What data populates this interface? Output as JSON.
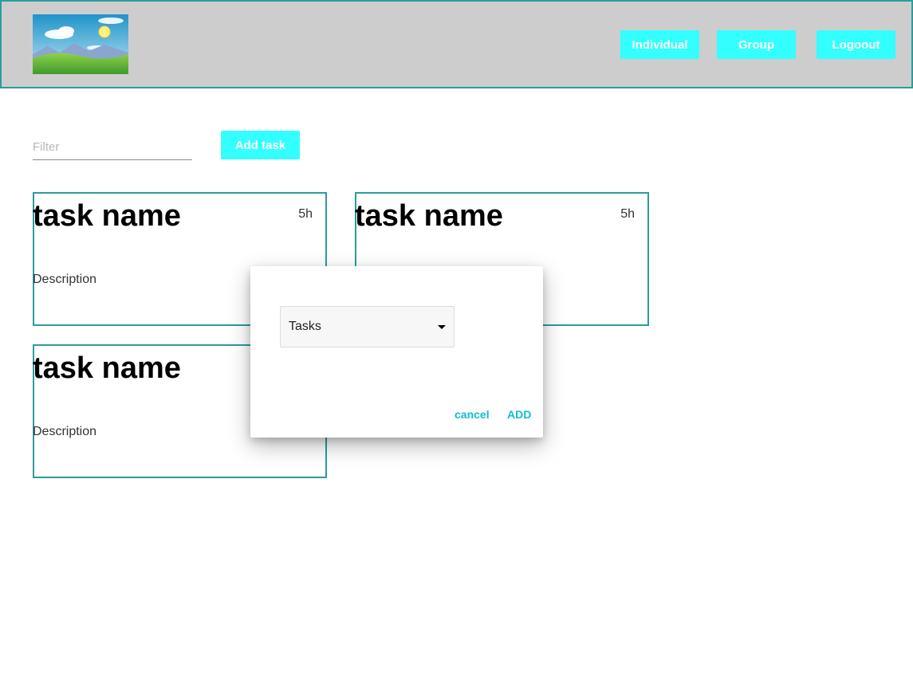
{
  "header": {
    "logo_icon": "landscape-logo-icon",
    "nav": {
      "individual_label": "Individual",
      "group_label": "Group",
      "logout_label": "Logoout"
    }
  },
  "toolbar": {
    "filter_placeholder": "Filter",
    "filter_value": "",
    "add_task_label": "Add task"
  },
  "tasks": [
    {
      "name": "task name",
      "hours": "5h",
      "description": "Description"
    },
    {
      "name": "task name",
      "hours": "5h",
      "description": ""
    },
    {
      "name": "task name",
      "hours": "",
      "description": "Description"
    }
  ],
  "dialog": {
    "select_value": "Tasks",
    "cancel_label": "cancel",
    "add_label": "ADD"
  },
  "colors": {
    "accent_button": "#33ffff",
    "card_border": "#2a9d9b",
    "header_bg": "#cdcdcd",
    "dialog_action": "#12bcd2"
  }
}
